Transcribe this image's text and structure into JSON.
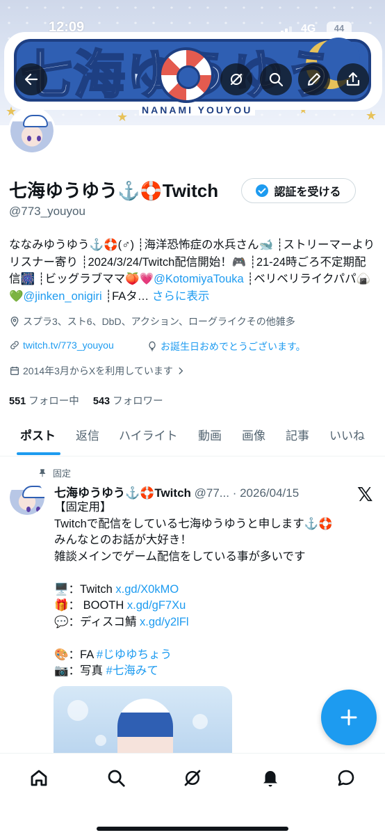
{
  "status_bar": {
    "time": "12:09",
    "network": "4G",
    "battery": "44"
  },
  "banner": {
    "logo_title": "七海ゆうゆう",
    "logo_subtitle": "NANAMI YOUYOU"
  },
  "header_buttons": {
    "back": "back-arrow-icon",
    "grok": "grok-icon",
    "search": "search-icon",
    "edit": "pencil-icon",
    "share": "share-icon"
  },
  "profile": {
    "display_name": "七海ゆうゆう⚓️🛟Twitch",
    "handle": "@773_youyou",
    "verify_button": "認証を受ける",
    "bio": {
      "part1": "ななみゆうゆう⚓️🛟(♂) ┊海洋恐怖症の水兵さん🐋 ┊ストリーマーよりリスナー寄り ┊2024/3/24/Twitch配信開始！🎮 ┊21-24時ごろ不定期配信🎆 ┊ビッグラブママ🍑💗",
      "mention1": "@KotomiyaTouka",
      "part2": " ┊ベリベリライクパパ🍙💚",
      "mention2": "@jinken_onigiri",
      "part3": " ┊FAタ…",
      "show_more": "さらに表示"
    },
    "location": "スプラ3、スト6、DbD、アクション、ローグライクその他雑多",
    "website": "twitch.tv/773_youyou",
    "birthday": "お誕生日おめでとうございます。",
    "joined": "2014年3月からXを利用しています",
    "following_count": "551",
    "following_label": "フォロー中",
    "followers_count": "543",
    "followers_label": "フォロワー"
  },
  "tabs": [
    "ポスト",
    "返信",
    "ハイライト",
    "動画",
    "画像",
    "記事",
    "いいね"
  ],
  "pinned_post": {
    "pinned_label": "固定",
    "author_name": "七海ゆうゆう⚓️🛟Twitch",
    "author_handle": "@77...",
    "date": "· 2026/04/15",
    "lines": {
      "l1": "【固定用】",
      "l2": "Twitchで配信をしている七海ゆうゆうと申します⚓️🛟",
      "l3": "みんなとのお話が大好き！",
      "l4": "雑談メインでゲーム配信をしている事が多いです",
      "twitch_label": "🖥️：Twitch ",
      "twitch_link": "x.gd/X0kMO",
      "booth_label": "🎁： BOOTH ",
      "booth_link": "x.gd/gF7Xu",
      "discord_label": "💬：ディスコ鯖 ",
      "discord_link": "x.gd/y2lFl",
      "fa_label": "🎨：FA ",
      "fa_tag": "#じゆゆちょう",
      "photo_label": "📷：写真 ",
      "photo_tag": "#七海みて"
    }
  },
  "bottom_nav": [
    "home-icon",
    "search-icon",
    "grok-icon",
    "notifications-icon",
    "messages-icon"
  ],
  "colors": {
    "accent": "#1d9bf0",
    "text": "#0f1419",
    "secondary": "#536471",
    "border": "#cfd9de"
  }
}
